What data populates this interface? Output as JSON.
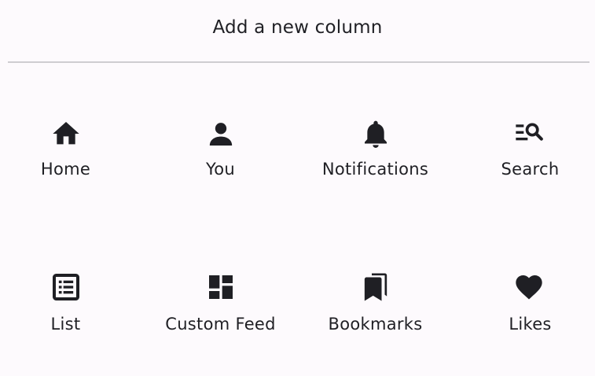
{
  "dialog": {
    "title": "Add a new column"
  },
  "options": [
    {
      "label": "Home",
      "icon": "home-icon"
    },
    {
      "label": "You",
      "icon": "person-icon"
    },
    {
      "label": "Notifications",
      "icon": "bell-icon"
    },
    {
      "label": "Search",
      "icon": "search-icon"
    },
    {
      "label": "List",
      "icon": "list-icon"
    },
    {
      "label": "Custom Feed",
      "icon": "dashboard-icon"
    },
    {
      "label": "Bookmarks",
      "icon": "bookmarks-icon"
    },
    {
      "label": "Likes",
      "icon": "heart-icon"
    }
  ],
  "colors": {
    "background": "#fdfafd",
    "text": "#1f1f24",
    "divider": "#cfcdd1"
  }
}
